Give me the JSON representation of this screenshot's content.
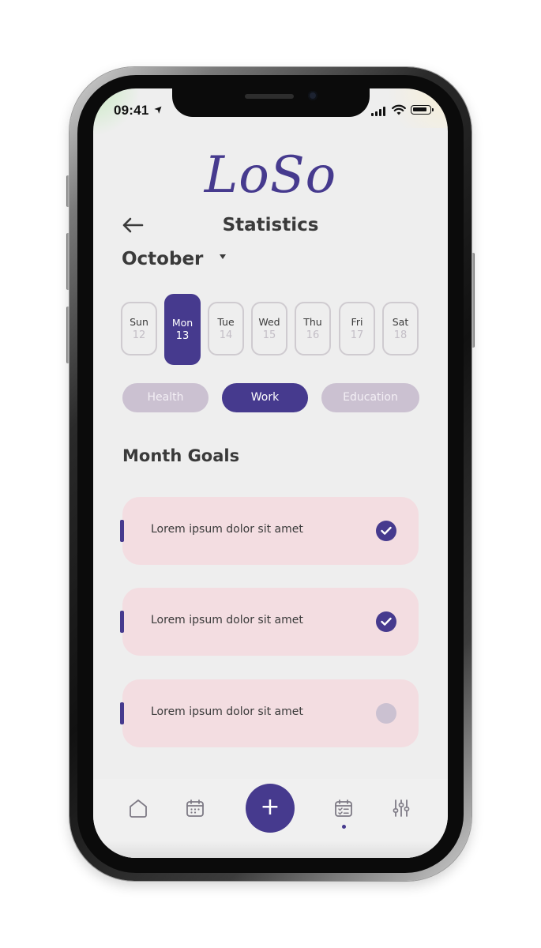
{
  "status_bar": {
    "time": "09:41",
    "location_arrow": "➤"
  },
  "app": {
    "logo": "LoSo",
    "title": "Statistics"
  },
  "month": {
    "label": "October"
  },
  "week": [
    {
      "day": "Sun",
      "date": "12",
      "active": false
    },
    {
      "day": "Mon",
      "date": "13",
      "active": true
    },
    {
      "day": "Tue",
      "date": "14",
      "active": false
    },
    {
      "day": "Wed",
      "date": "15",
      "active": false
    },
    {
      "day": "Thu",
      "date": "16",
      "active": false
    },
    {
      "day": "Fri",
      "date": "17",
      "active": false
    },
    {
      "day": "Sat",
      "date": "18",
      "active": false
    }
  ],
  "categories": [
    {
      "label": "Health",
      "active": false
    },
    {
      "label": "Work",
      "active": true
    },
    {
      "label": "Education",
      "active": false
    }
  ],
  "goals_section": {
    "title": "Month Goals"
  },
  "goals": [
    {
      "text": "Lorem ipsum dolor sit amet",
      "done": true
    },
    {
      "text": "Lorem ipsum dolor sit amet",
      "done": true
    },
    {
      "text": "Lorem ipsum dolor sit amet",
      "done": false
    }
  ],
  "tabbar": {
    "items": [
      "home-icon",
      "calendar-icon",
      "add-icon",
      "tasks-calendar-icon",
      "filters-icon"
    ],
    "add_symbol": "+",
    "active": "tasks-calendar-icon"
  },
  "colors": {
    "accent": "#463a8e",
    "muted_chip": "#cbc1d1",
    "goal_card": "#f3dde1",
    "background": "#eeeeee"
  }
}
